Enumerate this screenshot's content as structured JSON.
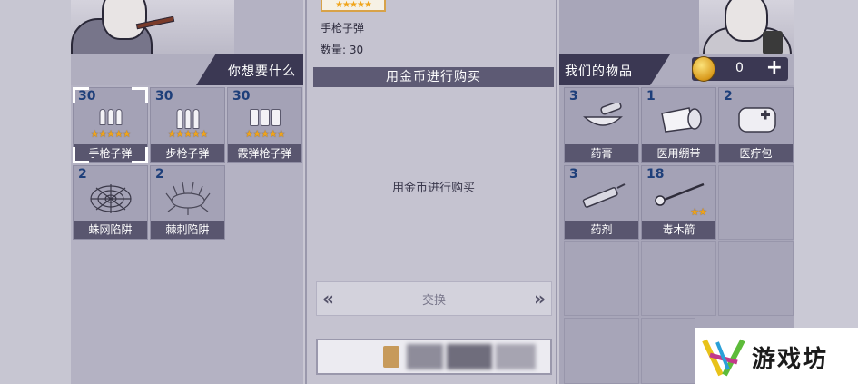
{
  "left_panel": {
    "title": "你想要什么",
    "items": [
      {
        "qty": "30",
        "label": "手枪子弹",
        "stars": "★★★★★",
        "icon": "pistol-ammo-icon",
        "selected": true
      },
      {
        "qty": "30",
        "label": "步枪子弹",
        "stars": "★★★★★",
        "icon": "rifle-ammo-icon"
      },
      {
        "qty": "30",
        "label": "霰弹枪子弹",
        "stars": "★★★★★",
        "icon": "shotgun-ammo-icon"
      },
      {
        "qty": "2",
        "label": "蛛网陷阱",
        "icon": "web-trap-icon"
      },
      {
        "qty": "2",
        "label": "棘刺陷阱",
        "icon": "spike-trap-icon"
      }
    ]
  },
  "center_panel": {
    "top_stars": "★★★★★",
    "item_name": "手枪子弹",
    "item_qty": "数量: 30",
    "buy_header": "用金币进行购买",
    "buy_message": "用金币进行购买",
    "exchange_left": "«",
    "exchange_label": "交换",
    "exchange_right": "»"
  },
  "right_panel": {
    "title": "我们的物品",
    "coins": "0",
    "plus": "+",
    "items": [
      {
        "qty": "3",
        "label": "药膏",
        "icon": "ointment-icon"
      },
      {
        "qty": "1",
        "label": "医用绷带",
        "icon": "bandage-icon"
      },
      {
        "qty": "2",
        "label": "医疗包",
        "icon": "medkit-icon"
      },
      {
        "qty": "3",
        "label": "药剂",
        "icon": "syringe-icon"
      },
      {
        "qty": "18",
        "label": "毒木箭",
        "stars": "★★",
        "icon": "poison-dart-icon"
      }
    ]
  },
  "watermark": {
    "text": "游戏坊"
  },
  "colors": {
    "accent": "#3b3853",
    "star": "#f0a41a",
    "qty": "#1e3f7a",
    "label_bar": "#59566f"
  }
}
